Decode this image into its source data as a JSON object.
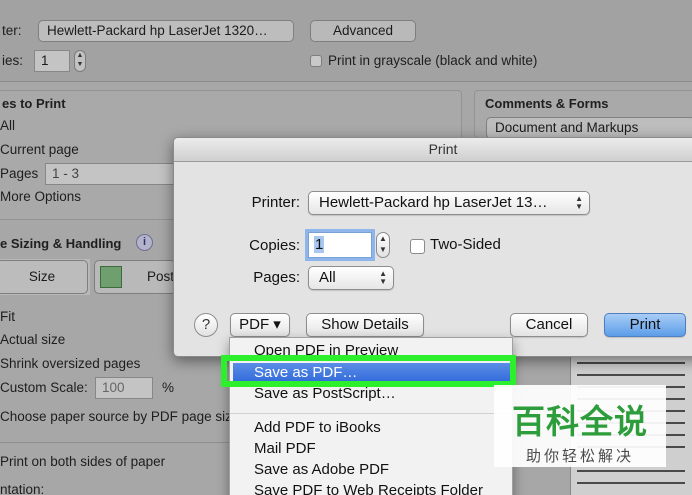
{
  "background": {
    "printer_label": "ter:",
    "printer_value": "Hewlett-Packard hp LaserJet 1320…",
    "advanced_button": "Advanced",
    "copies_label": "ies:",
    "copies_value": "1",
    "grayscale_label": "Print in grayscale (black and white)",
    "pages_to_print": {
      "heading": "es to Print",
      "all": "All",
      "current_page": "Current page",
      "pages_label": "Pages",
      "pages_range": "1 - 3",
      "more_options": "More Options"
    },
    "comments_forms": {
      "heading": "Comments & Forms",
      "value": "Document and Markups"
    },
    "sizing": {
      "heading": "e Sizing & Handling",
      "size_button": "Size",
      "poster_button": "Post",
      "fit": "Fit",
      "actual_size": "Actual size",
      "shrink": "Shrink oversized pages",
      "custom_scale_label": "Custom Scale:",
      "custom_scale_value": "100",
      "percent": "%",
      "paper_source": "Choose paper source by PDF page siz"
    },
    "print_both_sides": "Print on both sides of paper",
    "orientation_label": "ntation:"
  },
  "dialog": {
    "title": "Print",
    "printer_label": "Printer:",
    "printer_value": "Hewlett-Packard hp LaserJet 13…",
    "copies_label": "Copies:",
    "copies_value": "1",
    "two_sided_label": "Two-Sided",
    "pages_label": "Pages:",
    "pages_value": "All",
    "help_label": "?",
    "pdf_button": "PDF ▾",
    "show_details": "Show Details",
    "cancel": "Cancel",
    "print": "Print"
  },
  "pdf_menu": {
    "items": [
      "Open PDF in Preview",
      "Save as PDF…",
      "Save as PostScript…",
      "Add PDF to iBooks",
      "Mail PDF",
      "Save as Adobe PDF",
      "Save PDF to Web Receipts Folder"
    ],
    "selected_index": 1
  },
  "watermark": {
    "main": "百科全说",
    "sub": "助你轻松解决"
  },
  "colors": {
    "highlight_green": "#2bf02b",
    "menu_selection": "#2e67d9",
    "primary_button": "#5c9de8",
    "watermark_green": "#2c9d3a"
  }
}
